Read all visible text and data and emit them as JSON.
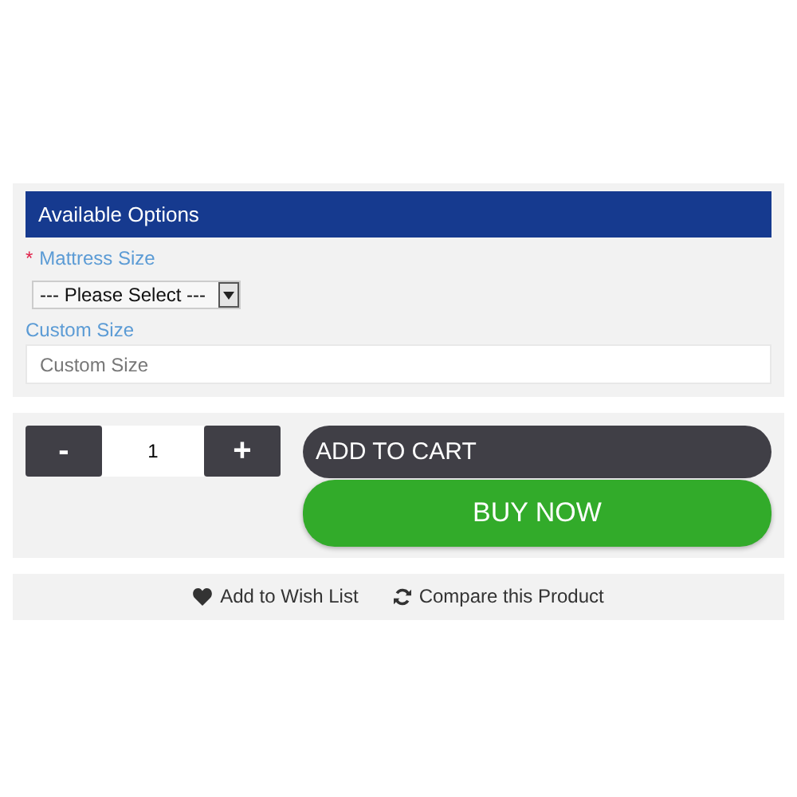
{
  "options": {
    "title": "Available Options",
    "fields": [
      {
        "kind": "select",
        "label": "Mattress Size",
        "required_mark": "*",
        "value": "--- Please Select ---"
      },
      {
        "kind": "text",
        "label": "Custom Size",
        "placeholder": "Custom Size"
      }
    ]
  },
  "quantity": {
    "minus": "-",
    "value": "1",
    "plus": "+"
  },
  "buttons": [
    {
      "kind": "cart",
      "label": "ADD TO CART"
    },
    {
      "kind": "buy",
      "label": "BUY NOW"
    }
  ],
  "links": [
    {
      "kind": "wishlist",
      "label": "Add to Wish List"
    },
    {
      "kind": "compare",
      "label": "Compare this Product"
    }
  ]
}
